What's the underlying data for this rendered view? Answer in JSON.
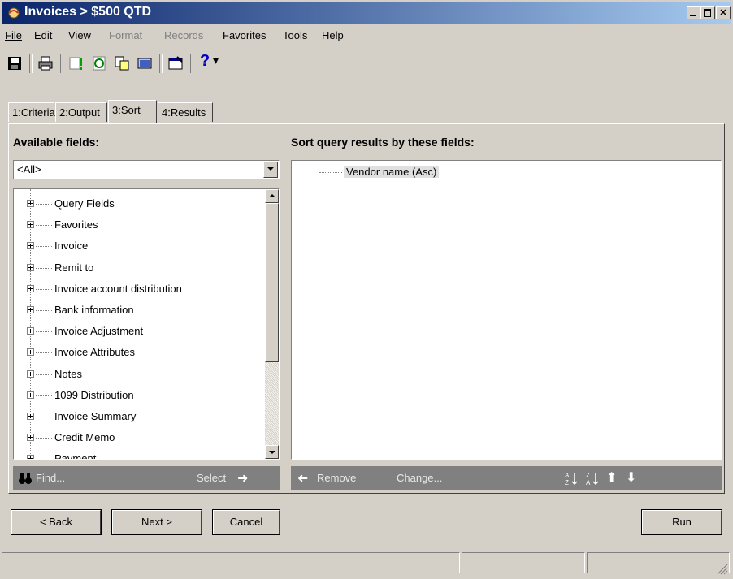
{
  "window": {
    "title": "Invoices > $500 QTD"
  },
  "menubar": [
    {
      "label": "File",
      "disabled": false
    },
    {
      "label": "Edit",
      "disabled": false
    },
    {
      "label": "View",
      "disabled": false
    },
    {
      "label": "Format",
      "disabled": true
    },
    {
      "label": "Records",
      "disabled": true
    },
    {
      "label": "Favorites",
      "disabled": false
    },
    {
      "label": "Tools",
      "disabled": false
    },
    {
      "label": "Help",
      "disabled": false
    }
  ],
  "toolbar": {
    "icons": [
      "save-icon",
      "print-icon",
      "run-query-icon",
      "refresh-icon",
      "copy-icon",
      "export-icon",
      "properties-icon",
      "help-icon"
    ]
  },
  "tabs": [
    {
      "label": "1:Criteria",
      "active": false
    },
    {
      "label": "2:Output",
      "active": false
    },
    {
      "label": "3:Sort",
      "active": true
    },
    {
      "label": "4:Results",
      "active": false
    }
  ],
  "left": {
    "heading": "Available fields:",
    "filter_value": "<All>",
    "tree": [
      "Query Fields",
      "Favorites",
      "Invoice",
      "Remit to",
      "Invoice account distribution",
      "Bank information",
      "Invoice Adjustment",
      "Invoice Attributes",
      "Notes",
      "1099 Distribution",
      "Invoice Summary",
      "Credit Memo",
      "Payment"
    ],
    "find_label": "Find...",
    "select_label": "Select"
  },
  "right": {
    "heading": "Sort query results by these fields:",
    "sort_fields": [
      "Vendor name (Asc)"
    ],
    "remove_label": "Remove",
    "change_label": "Change..."
  },
  "buttons": {
    "back": "< Back",
    "next": "Next >",
    "cancel": "Cancel",
    "run": "Run"
  }
}
